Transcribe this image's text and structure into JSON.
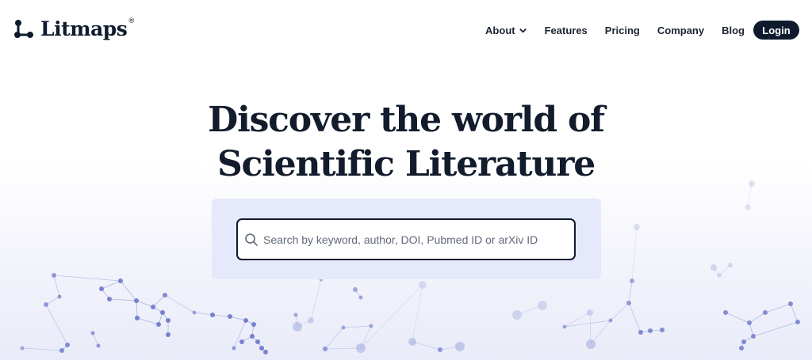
{
  "brand": {
    "name": "Litmaps",
    "registered_mark": "®",
    "icon": "litmaps-network-logo-icon"
  },
  "nav": {
    "items": [
      {
        "label": "About",
        "has_dropdown": true
      },
      {
        "label": "Features"
      },
      {
        "label": "Pricing"
      },
      {
        "label": "Company"
      },
      {
        "label": "Blog"
      }
    ],
    "login_label": "Login"
  },
  "hero": {
    "title_line1": "Discover the world of",
    "title_line2": "Scientific Literature"
  },
  "search": {
    "value": "",
    "placeholder": "Search by keyword, author, DOI, Pubmed ID or arXiv ID",
    "icon": "search-icon"
  },
  "colors": {
    "brand_dark": "#0f1b2d",
    "search_panel_bg": "#e5e9fb",
    "network_node": "#6b77c9"
  }
}
